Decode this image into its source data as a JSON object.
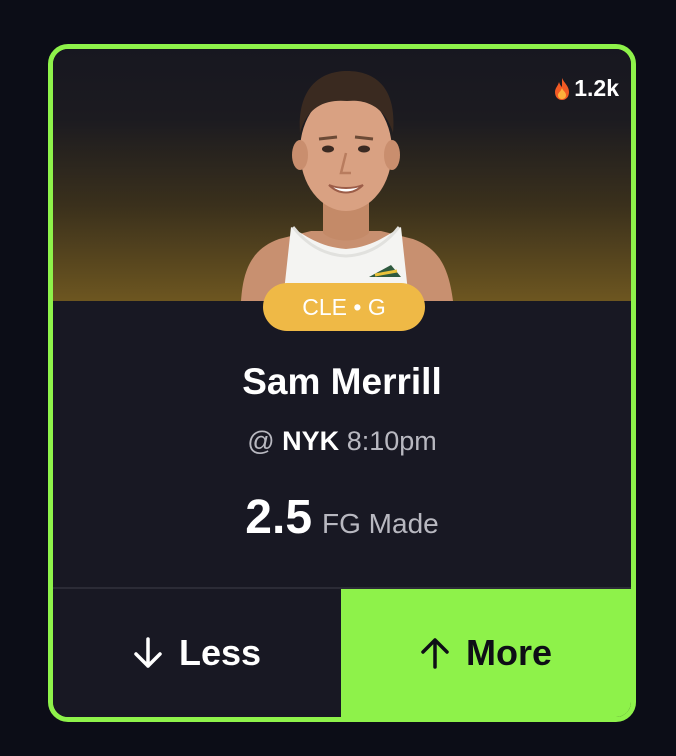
{
  "card": {
    "popularity": "1.2k",
    "popularity_icon": "fire-icon",
    "badge": "CLE • G",
    "player_name": "Sam Merrill",
    "matchup_prefix": "@",
    "opponent": "NYK",
    "game_time": "8:10pm",
    "line_value": "2.5",
    "stat_name": "FG Made"
  },
  "buttons": {
    "less_label": "Less",
    "less_icon": "arrow-down-icon",
    "more_label": "More",
    "more_icon": "arrow-up-icon"
  },
  "colors": {
    "accent": "#8ef24a",
    "badge": "#efb946",
    "card_background": "#181823",
    "page_background": "#0c0d17"
  }
}
